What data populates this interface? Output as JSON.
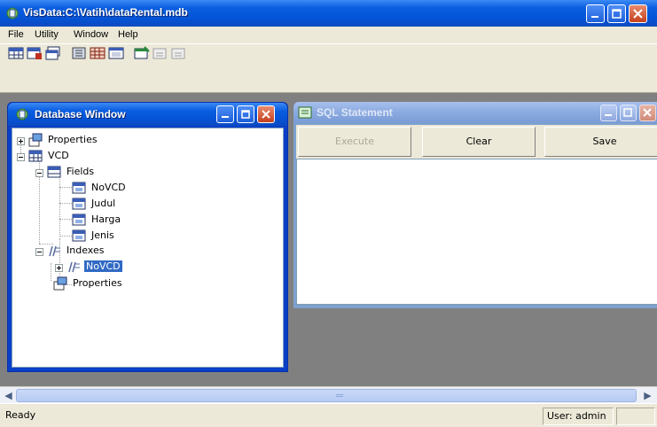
{
  "app": {
    "title": "VisData:C:\\Vatih\\dataRental.mdb",
    "menu": [
      "File",
      "Utility",
      "Window",
      "Help"
    ]
  },
  "toolbar": {
    "icons": [
      "table-type-icon",
      "dynaset-type-icon",
      "snapshot-type-icon",
      "data-control-icon",
      "dbgrid-icon",
      "form-icon",
      "begin-transaction-icon",
      "commit-icon",
      "rollback-icon"
    ]
  },
  "database_window": {
    "title": "Database Window",
    "tree": {
      "properties": "Properties",
      "table": "VCD",
      "fields": "Fields",
      "field_items": [
        "NoVCD",
        "Judul",
        "Harga",
        "Jenis"
      ],
      "indexes": "Indexes",
      "index_item": "NoVCD",
      "table_properties": "Properties"
    }
  },
  "sql_window": {
    "title": "SQL Statement",
    "execute_label": "Execute",
    "clear_label": "Clear",
    "save_label": "Save"
  },
  "status": {
    "left": "Ready",
    "user": "User: admin"
  },
  "colors": {
    "title_blue": "#0553d6",
    "selection": "#316ac5",
    "face": "#ece9d8",
    "mdi_background": "#808080"
  }
}
